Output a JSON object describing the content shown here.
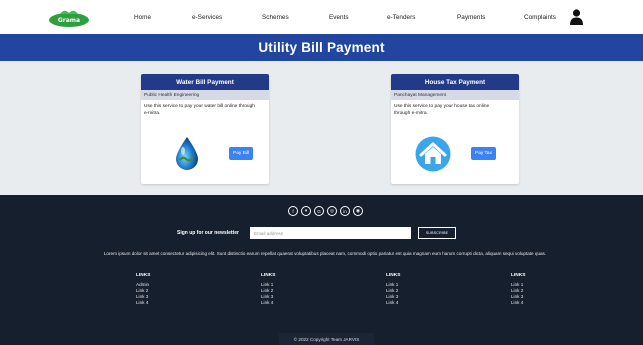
{
  "nav": {
    "logo_text": "Grama",
    "items": [
      "Home",
      "e-Services",
      "Schemes",
      "Events",
      "e-Tenders",
      "Payments",
      "Complaints"
    ]
  },
  "page_title": "Utility Bill Payment",
  "cards": [
    {
      "title": "Water Bill Payment",
      "department": "Public Health Engineering",
      "description": "Use this service to pay your water bill online through e-mitra.",
      "button": "Pay Bill",
      "icon": "water-drop-icon"
    },
    {
      "title": "House Tax Payment",
      "department": "Panchayat Management",
      "description": "Use this service to pay your house tax online through e-mitra.",
      "button": "Pay Tax",
      "icon": "house-icon"
    }
  ],
  "footer": {
    "socials": [
      "facebook-icon",
      "twitter-icon",
      "google-icon",
      "instagram-icon",
      "linkedin-icon",
      "github-icon"
    ],
    "newsletter_label": "Sign up for our newsletter",
    "newsletter_placeholder": "Email address",
    "subscribe": "SUBSCRIBE",
    "lorem": "Lorem ipsum dolor sit amet consectetur adipisicing elit. Sunt distinctio earum repellat quaerat voluptatibus placeat nam, commodi optio pariatur est quia magnam eum harum corrupti dicta, aliquam sequi voluptate quas.",
    "link_columns": [
      {
        "title": "LINKS",
        "links": [
          "Admin",
          "Link 2",
          "Link 3",
          "Link 4"
        ]
      },
      {
        "title": "LINKS",
        "links": [
          "Link 1",
          "Link 2",
          "Link 3",
          "Link 4"
        ]
      },
      {
        "title": "LINKS",
        "links": [
          "Link 1",
          "Link 2",
          "Link 3",
          "Link 4"
        ]
      },
      {
        "title": "LINKS",
        "links": [
          "Link 1",
          "Link 2",
          "Link 3",
          "Link 4"
        ]
      }
    ],
    "copyright": "© 2022 Copyright Team JARVIS"
  },
  "colors": {
    "banner": "#2246a0",
    "card_header": "#233a88",
    "button": "#3b82f6",
    "footer": "#161f2e"
  }
}
